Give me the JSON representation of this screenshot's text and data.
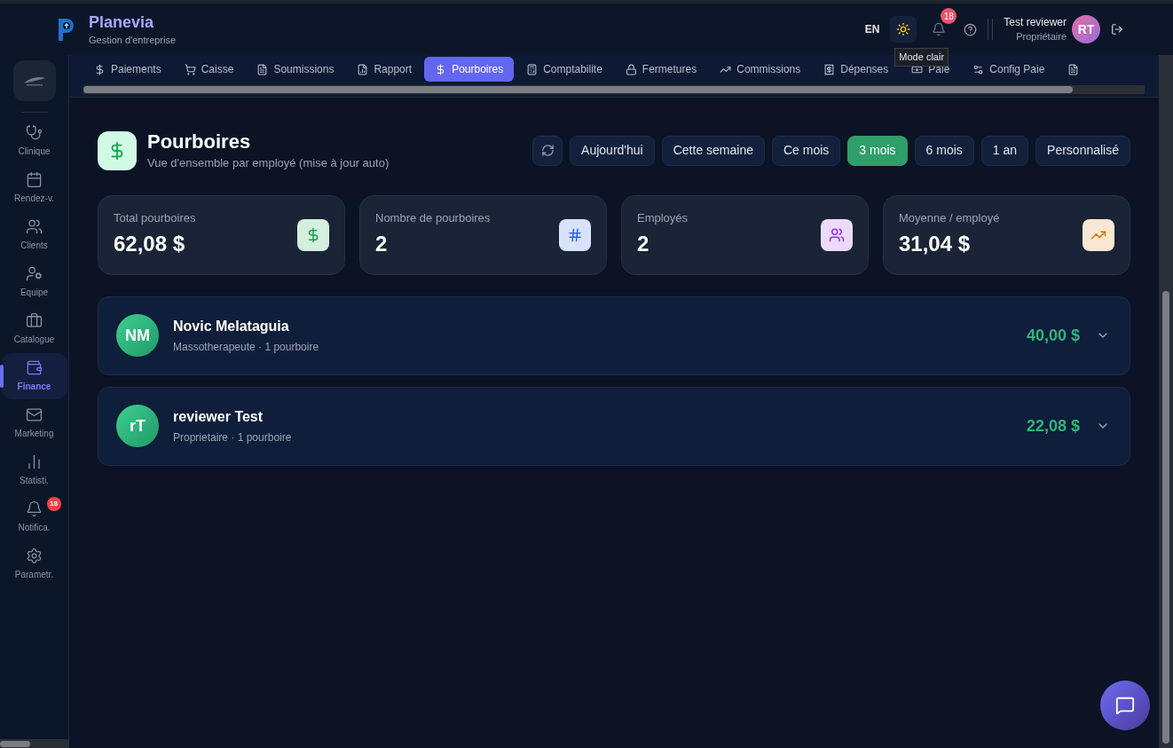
{
  "header": {
    "brand": "Planevia",
    "tagline": "Gestion d'entreprise",
    "language": "EN",
    "theme_tooltip": "Mode clair",
    "notification_count": "18",
    "user": {
      "name": "Test reviewer",
      "role": "Propriétaire",
      "initials": "RT"
    }
  },
  "sidebar": {
    "items": [
      {
        "label": "Clinique",
        "selected": false
      },
      {
        "label": "Rendez-v.",
        "selected": false
      },
      {
        "label": "Clients",
        "selected": false
      },
      {
        "label": "Equipe",
        "selected": false
      },
      {
        "label": "Catalogue",
        "selected": false
      },
      {
        "label": "Finance",
        "selected": true
      },
      {
        "label": "Marketing",
        "selected": false
      },
      {
        "label": "Statisti.",
        "selected": false
      },
      {
        "label": "Notifica.",
        "selected": false,
        "badge": "18"
      },
      {
        "label": "Parametr.",
        "selected": false
      }
    ]
  },
  "tabs": [
    {
      "kind": "text",
      "label": "Paiements",
      "selected": false
    },
    {
      "kind": "text",
      "label": "Caisse",
      "selected": false
    },
    {
      "kind": "text",
      "label": "Soumissions",
      "selected": false
    },
    {
      "kind": "text",
      "label": "Rapport",
      "selected": false
    },
    {
      "kind": "text",
      "label": "Pourboires",
      "selected": true
    },
    {
      "kind": "text",
      "label": "Comptabilite",
      "selected": false
    },
    {
      "kind": "text",
      "label": "Fermetures",
      "selected": false
    },
    {
      "kind": "text",
      "label": "Commissions",
      "selected": false
    },
    {
      "kind": "text",
      "label": "Dépenses",
      "selected": false
    },
    {
      "kind": "text",
      "label": "Paie",
      "selected": false
    },
    {
      "kind": "text",
      "label": "Config Paie",
      "selected": false
    },
    {
      "kind": "icon",
      "selected": false
    }
  ],
  "page": {
    "title": "Pourboires",
    "subtitle": "Vue d'ensemble par employé (mise à jour auto)",
    "periods": [
      {
        "label": "Aujourd'hui",
        "selected": false
      },
      {
        "label": "Cette semaine",
        "selected": false
      },
      {
        "label": "Ce mois",
        "selected": false
      },
      {
        "label": "3 mois",
        "selected": true
      },
      {
        "label": "6 mois",
        "selected": false
      },
      {
        "label": "1 an",
        "selected": false
      },
      {
        "label": "Personnalisé",
        "selected": false
      }
    ]
  },
  "stats": [
    {
      "label": "Total pourboires",
      "value": "62,08 $",
      "color": "#16a34a"
    },
    {
      "label": "Nombre de pourboires",
      "value": "2",
      "color": "#2563eb"
    },
    {
      "label": "Employés",
      "value": "2",
      "color": "#9333ea"
    },
    {
      "label": "Moyenne / employé",
      "value": "31,04 $",
      "color": "#d97706"
    }
  ],
  "employees": [
    {
      "initials": "NM",
      "name": "Novic Melataguia",
      "details": "Massotherapeute · 1 pourboire",
      "amount": "40,00 $",
      "expanded": false
    },
    {
      "initials": "rT",
      "name": "reviewer Test",
      "details": "Proprietaire · 1 pourboire",
      "amount": "22,08 $",
      "expanded": false
    }
  ]
}
